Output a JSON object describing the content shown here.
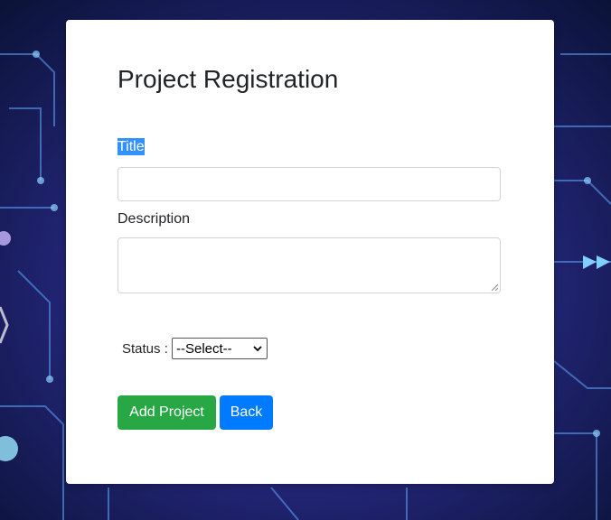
{
  "form": {
    "heading": "Project Registration",
    "title_label": "Title",
    "title_value": "",
    "description_label": "Description",
    "description_value": "",
    "status_label": "Status :",
    "status_selected": "--Select--",
    "add_button": "Add Project",
    "back_button": "Back"
  },
  "colors": {
    "add_button": "#28a745",
    "back_button": "#007bff",
    "highlight": "#3390ff",
    "background": "#0b1540"
  },
  "icons": {
    "select_arrow": "chevron-down-icon",
    "resize": "resize-grip-icon"
  }
}
